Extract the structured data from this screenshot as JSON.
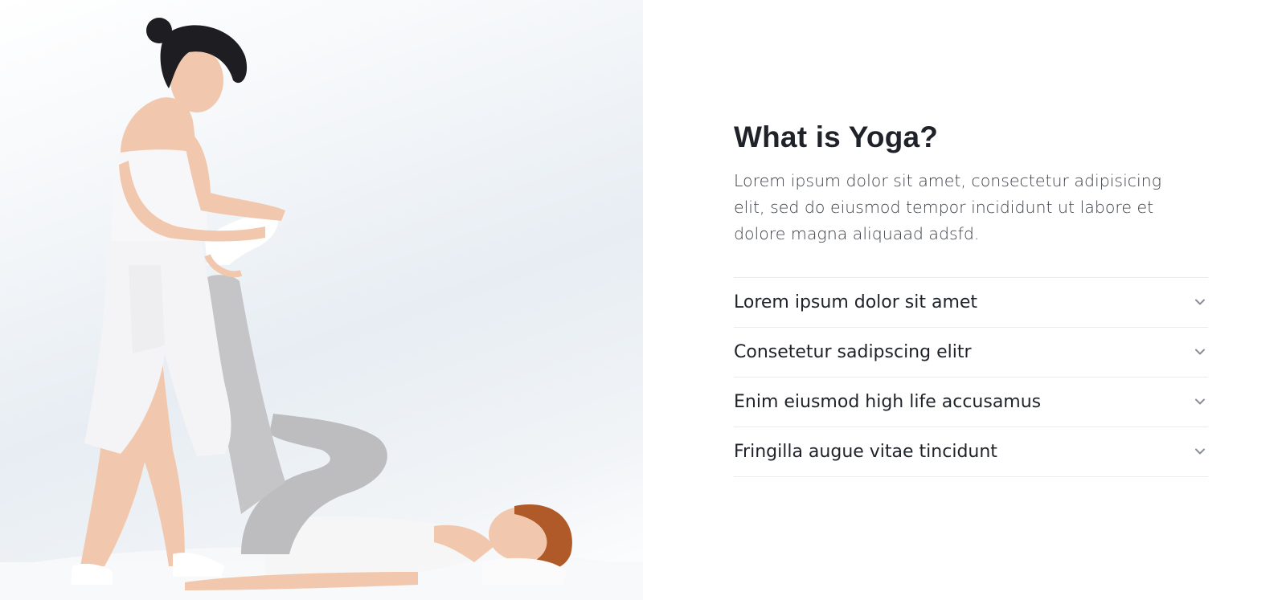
{
  "hero": {
    "image": "yoga-stretching-photo",
    "colors": {
      "background": "#e7edf3",
      "clothing_white": "#f4f4f6",
      "clothing_gray": "#bdbdbf",
      "hair_dark": "#1e1e22",
      "hair_red": "#b05a2a",
      "skin": "#f1c8ad"
    }
  },
  "main": {
    "title": "What is Yoga?",
    "lead": "Lorem ipsum dolor sit amet, consectetur adipisicing elit, sed do eiusmod tempor incididunt ut labore et dolore magna aliquaad adsfd.",
    "accordion": [
      {
        "label": "Lorem ipsum dolor sit amet",
        "icon": "chevron-down-icon"
      },
      {
        "label": "Consetetur sadipscing elitr",
        "icon": "chevron-down-icon"
      },
      {
        "label": "Enim eiusmod high life accusamus",
        "icon": "chevron-down-icon"
      },
      {
        "label": "Fringilla augue vitae tincidunt",
        "icon": "chevron-down-icon"
      }
    ]
  },
  "colors": {
    "text": "#1f2329",
    "divider": "#e9ecef",
    "chevron": "#8a8f96"
  }
}
